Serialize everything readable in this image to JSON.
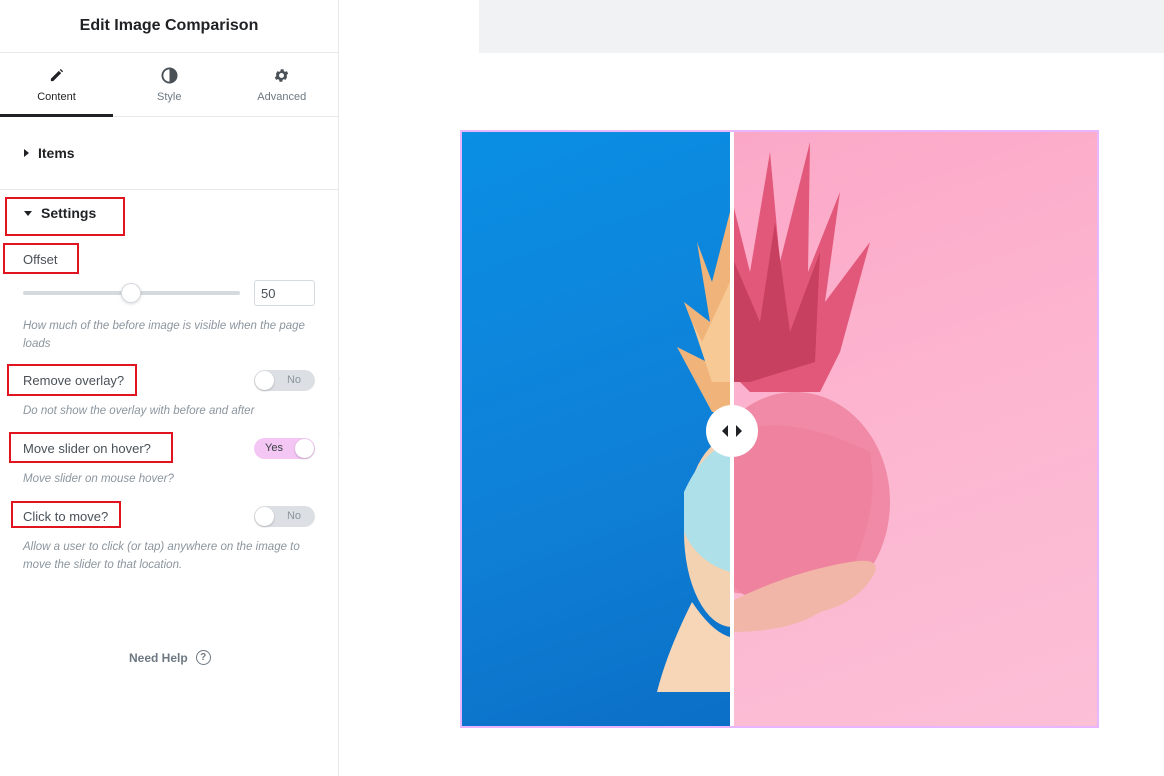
{
  "panel": {
    "title": "Edit Image Comparison",
    "tabs": [
      {
        "label": "Content",
        "icon": "pencil-icon",
        "active": true
      },
      {
        "label": "Style",
        "icon": "half-circle-icon",
        "active": false
      },
      {
        "label": "Advanced",
        "icon": "gear-icon",
        "active": false
      }
    ],
    "sections": {
      "items": "Items",
      "settings": "Settings"
    },
    "offset": {
      "label": "Offset",
      "value": "50",
      "slider_percent": 50,
      "description": "How much of the before image is visible when the page loads"
    },
    "remove_overlay": {
      "label": "Remove overlay?",
      "state": "No",
      "description": "Do not show the overlay with before and after"
    },
    "move_on_hover": {
      "label": "Move slider on hover?",
      "state": "Yes",
      "description": "Move slider on mouse hover?"
    },
    "click_to_move": {
      "label": "Click to move?",
      "state": "No",
      "description": "Allow a user to click (or tap) anywhere on the image to move the slider to that location."
    },
    "help": "Need Help",
    "help_symbol": "?"
  },
  "colors": {
    "highlight_box": "#e0141e",
    "toggle_on": "#f3c6f4",
    "toggle_off": "#dcdfe3",
    "before_bg": "#0a8fe4",
    "after_bg": "#fdb6d0",
    "frame_border": "#e8b6ff"
  }
}
